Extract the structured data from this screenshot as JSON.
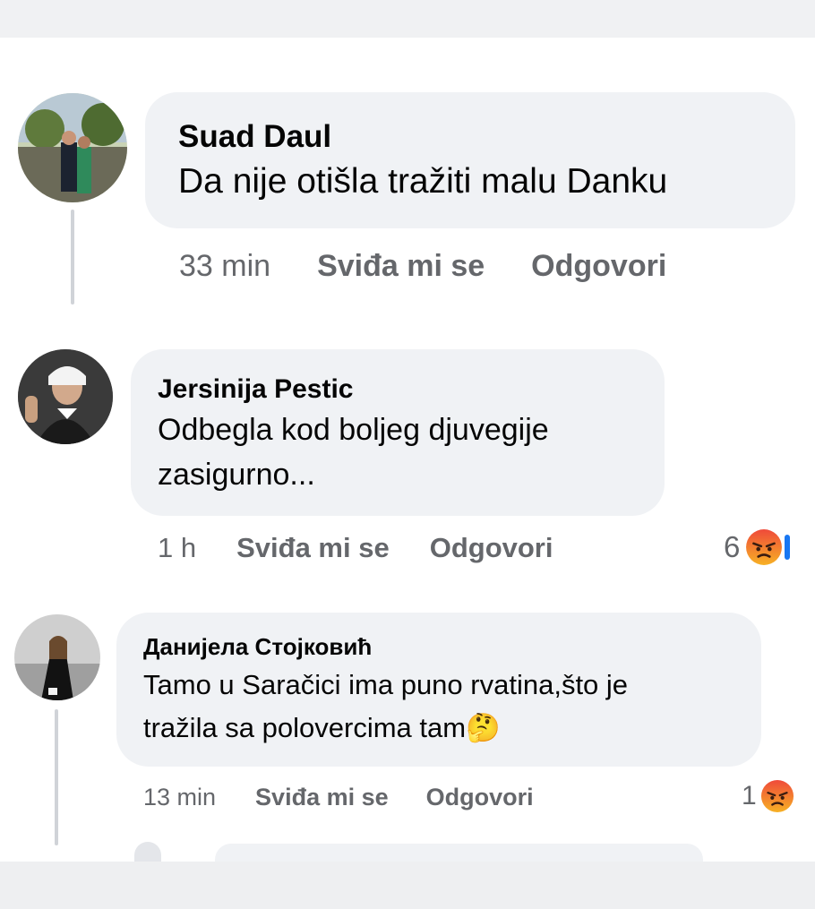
{
  "comments": [
    {
      "author": "Suad Daul",
      "text": "Da nije otišla tražiti malu Danku",
      "time": "33 min",
      "like_label": "Sviđa mi se",
      "reply_label": "Odgovori"
    },
    {
      "author": "Jersinija Pestic",
      "text_line1": "Odbegla kod boljeg djuvegije",
      "text_line2": "zasigurno...",
      "time": "1 h",
      "like_label": "Sviđa mi se",
      "reply_label": "Odgovori",
      "reaction_count": "6",
      "reaction_icon": "angry-emoji"
    },
    {
      "author": "Данијела Стојковић",
      "text_line1": "Tamo u Saračici ima puno rvatina,što je",
      "text_line2": "tražila sa polovercima tam",
      "text_emoji": "🤔",
      "time": "13 min",
      "like_label": "Sviđa mi se",
      "reply_label": "Odgovori",
      "reaction_count": "1",
      "reaction_icon": "angry-emoji"
    }
  ],
  "colors": {
    "bubble": "#f0f2f5",
    "meta_text": "#65676b",
    "angry_top": "#ef4a3a",
    "angry_bottom": "#f7b125"
  }
}
